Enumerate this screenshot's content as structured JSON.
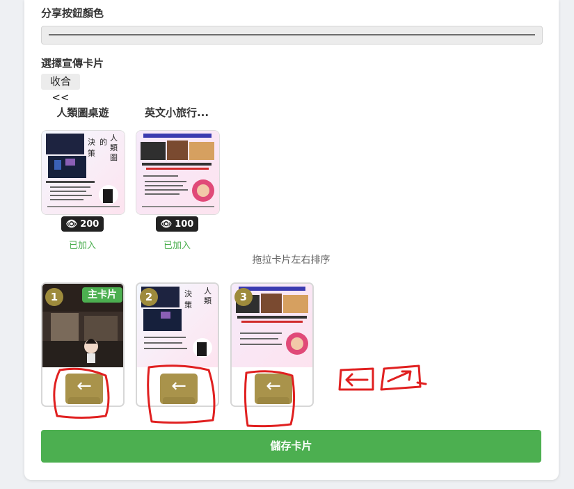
{
  "section_share_color": {
    "label": "分享按鈕顏色"
  },
  "section_cards": {
    "label": "選擇宣傳卡片",
    "collapse_label": "收合 <<"
  },
  "available_cards": [
    {
      "title": "人類圖桌遊",
      "views": "200",
      "status": "已加入"
    },
    {
      "title": "英文小旅行...",
      "views": "100",
      "status": "已加入"
    }
  ],
  "drag_hint": "拖拉卡片左右排序",
  "selected_slots": [
    {
      "number": "1",
      "badge": "主卡片",
      "arrow": "←"
    },
    {
      "number": "2",
      "arrow": "←"
    },
    {
      "number": "3",
      "arrow": "←"
    }
  ],
  "save_button": {
    "label": "儲存卡片"
  },
  "colors": {
    "accent_green": "#4caf50",
    "gold_button": "#a9934b",
    "annotation_red": "#e02020"
  }
}
